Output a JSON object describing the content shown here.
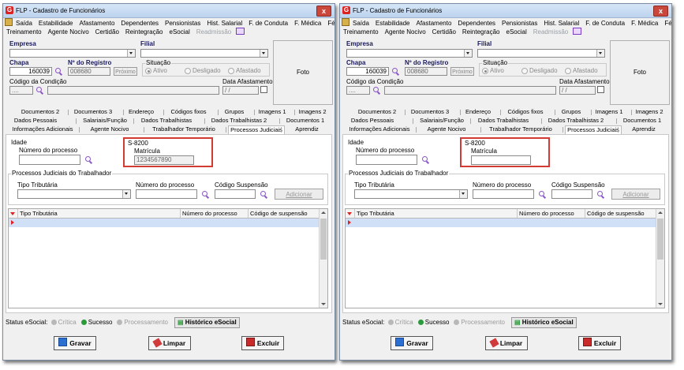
{
  "window_title": "FLP - Cadastro de Funcionários",
  "close_label": "x",
  "menu_row1": [
    "Saída",
    "Estabilidade",
    "Afastamento",
    "Dependentes",
    "Pensionistas",
    "Hist. Salarial",
    "F. de Conduta",
    "F. Médica",
    "Férias"
  ],
  "menu_row2": [
    "Treinamento",
    "Agente Nocivo",
    "Certidão",
    "Reintegração",
    "eSocial",
    "Readmissão"
  ],
  "header": {
    "empresa_label": "Empresa",
    "filial_label": "Filial",
    "chapa_label": "Chapa",
    "chapa_value": "160039",
    "registro_label": "Nº do Registro",
    "registro_value": "008680",
    "proximo_label": "Próximo",
    "situacao_label": "Situação",
    "situacao_options": [
      "Ativo",
      "Desligado",
      "Afastado"
    ],
    "condicao_label": "Código da Condição",
    "condicao_value": "....",
    "data_afast_label": "Data Afastamento",
    "data_afast_value": "/ /",
    "foto_label": "Foto"
  },
  "tabs_row1": [
    "Documentos 2",
    "Documentos 3",
    "Endereço",
    "Códigos fixos",
    "Grupos",
    "Imagens 1",
    "Imagens 2"
  ],
  "tabs_row2": [
    "Dados Pessoais",
    "Salariais/Função",
    "Dados Trabalhistas",
    "Dados Trabalhistas 2",
    "Documentos 1"
  ],
  "tabs_row3": [
    "Informações Adicionais",
    "Agente Nocivo",
    "Trabalhador Temporário",
    "Processos Judiciais",
    "Aprendiz"
  ],
  "active_tab": "Processos Judiciais",
  "panel": {
    "idade_label": "Idade",
    "numero_processo_label": "Número do processo",
    "s8200_label": "S-8200",
    "matricula_label": "Matrícula",
    "left_matricula_value": "1234567890",
    "right_matricula_value": "",
    "group_label": "Processos Judiciais do Trabalhador",
    "tipo_tributaria_label": "Tipo Tributária",
    "numero_processo_label2": "Número do processo",
    "codigo_suspensao_label": "Código Suspensão",
    "adicionar_label": "Adicionar"
  },
  "grid": {
    "columns": [
      "Tipo Tributária",
      "Número do processo",
      "Código de suspensão"
    ]
  },
  "status": {
    "label": "Status eSocial:",
    "items": [
      {
        "label": "Crítica",
        "color": "#b8b8b8"
      },
      {
        "label": "Sucesso",
        "color": "#2b9a3a"
      },
      {
        "label": "Processamento",
        "color": "#b8b8b8"
      }
    ],
    "history_label": "Histórico eSocial"
  },
  "buttons": {
    "gravar": "Gravar",
    "limpar": "Limpar",
    "excluir": "Excluir"
  },
  "colors": {
    "highlight": "#d23a34",
    "grid_selected_row": "#cfe0f7"
  }
}
